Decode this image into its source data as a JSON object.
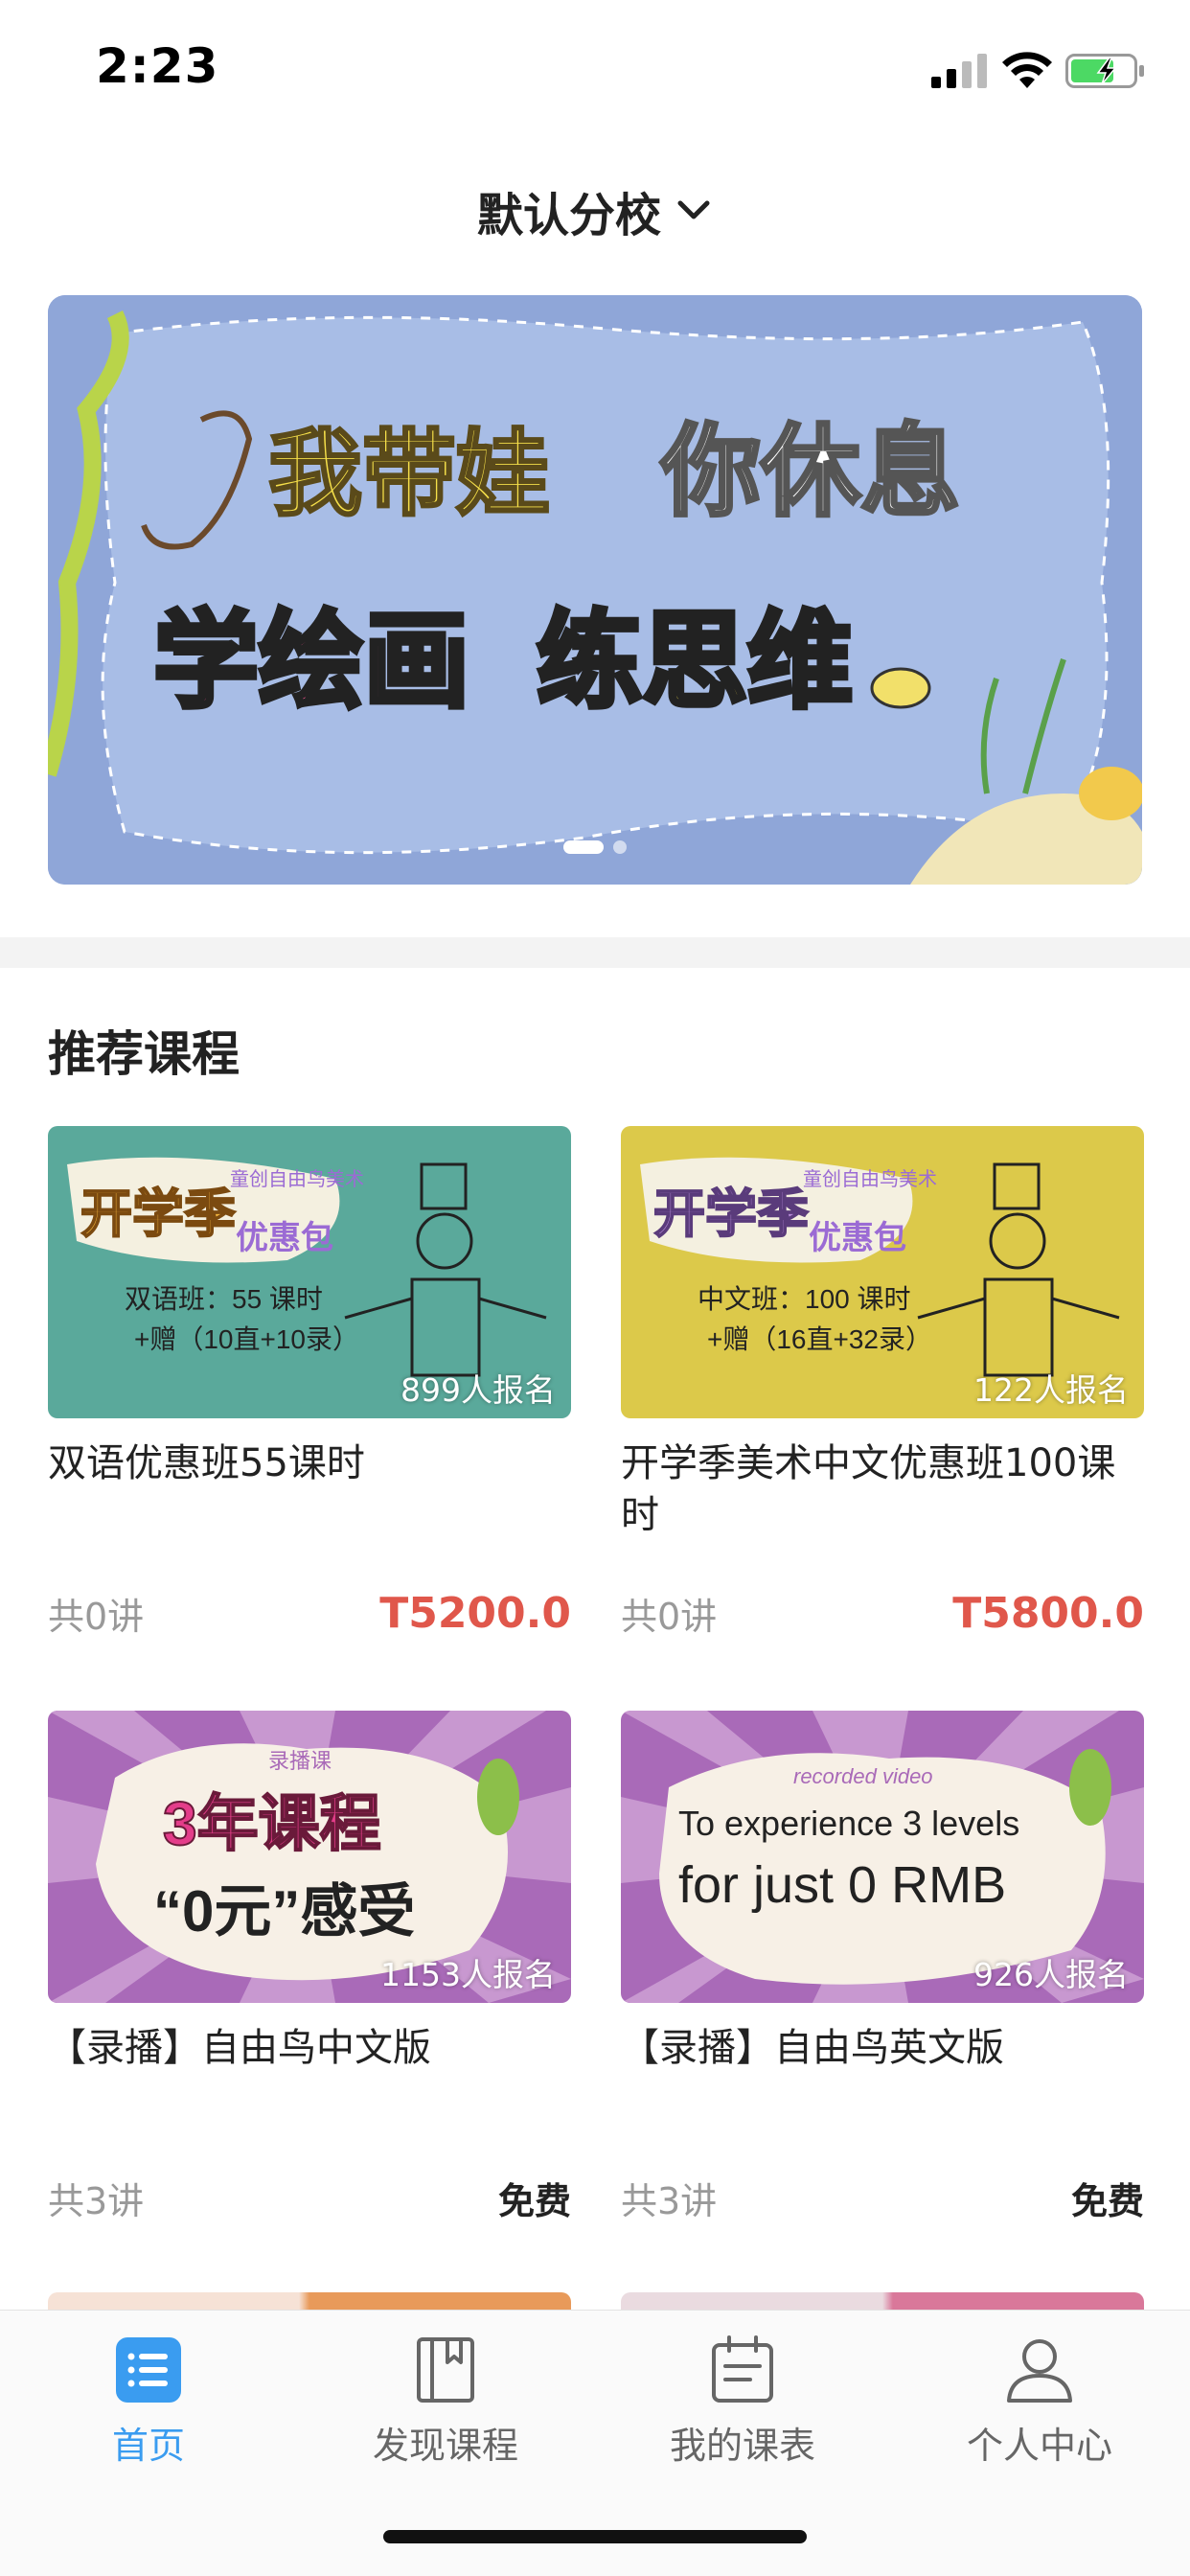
{
  "status_bar": {
    "time": "2:23"
  },
  "header": {
    "campus": "默认分校"
  },
  "banner": {
    "line1_a": "我带娃",
    "line1_b": "你休息",
    "line2_a": "学绘画",
    "line2_b": "练思维",
    "slide_count": 2,
    "active_slide": 0
  },
  "section": {
    "title": "推荐课程"
  },
  "courses": [
    {
      "title": "双语优惠班55课时",
      "enrolled": "899人报名",
      "lessons": "共0讲",
      "price": "T5200.0",
      "thumb": {
        "head": "开学季",
        "sub": "优惠包",
        "brand": "童创自由鸟美术",
        "line1": "双语班：55 课时",
        "line2": "+赠（10直+10录）"
      }
    },
    {
      "title": "开学季美术中文优惠班100课时",
      "enrolled": "122人报名",
      "lessons": "共0讲",
      "price": "T5800.0",
      "thumb": {
        "head": "开学季",
        "sub": "优惠包",
        "brand": "童创自由鸟美术",
        "line1": "中文班：100 课时",
        "line2": "+赠（16直+32录）"
      }
    },
    {
      "title": "【录播】自由鸟中文版",
      "enrolled": "1153人报名",
      "lessons": "共3讲",
      "price": "免费",
      "thumb": {
        "top": "录播课",
        "line1": "3年课程",
        "line2": "“0元”感受"
      }
    },
    {
      "title": "【录播】自由鸟英文版",
      "enrolled": "926人报名",
      "lessons": "共3讲",
      "price": "免费",
      "thumb": {
        "top": "recorded video",
        "line1": "To experience 3 levels",
        "line2": "for just 0 RMB"
      }
    }
  ],
  "tabs": [
    {
      "label": "首页",
      "icon": "list-icon",
      "active": true
    },
    {
      "label": "发现课程",
      "icon": "book-icon",
      "active": false
    },
    {
      "label": "我的课表",
      "icon": "clipboard-icon",
      "active": false
    },
    {
      "label": "个人中心",
      "icon": "person-icon",
      "active": false
    }
  ],
  "colors": {
    "accent": "#3a9cf0",
    "price": "#e0574b",
    "banner_bg": "#8fa6d8"
  }
}
